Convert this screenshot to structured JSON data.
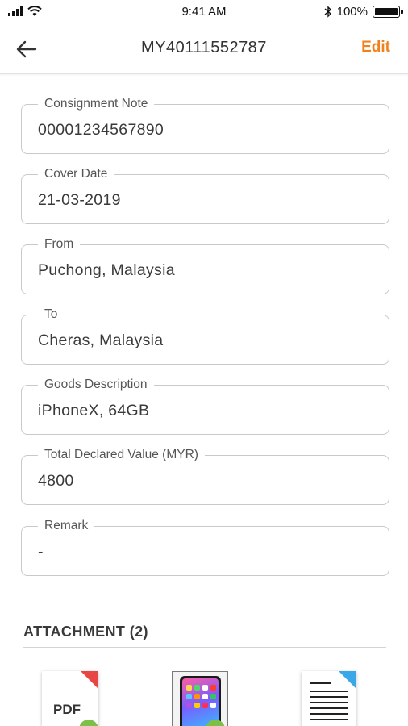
{
  "status_bar": {
    "time": "9:41 AM",
    "battery": "100%",
    "icons": [
      "signal-icon",
      "wifi-icon",
      "bluetooth-icon",
      "battery-icon"
    ]
  },
  "header": {
    "title": "MY40111552787",
    "edit_label": "Edit",
    "back_icon": "back-arrow-icon",
    "accent_color": "#f0821e"
  },
  "fields": [
    {
      "label": "Consignment Note",
      "value": "00001234567890"
    },
    {
      "label": "Cover Date",
      "value": "21-03-2019"
    },
    {
      "label": "From",
      "value": "Puchong, Malaysia"
    },
    {
      "label": "To",
      "value": "Cheras, Malaysia"
    },
    {
      "label": "Goods Description",
      "value": "iPhoneX, 64GB"
    },
    {
      "label": "Total Declared Value (MYR)",
      "value": "4800"
    },
    {
      "label": "Remark",
      "value": "-"
    }
  ],
  "attachments": {
    "title": "ATTACHMENT (2)",
    "items": [
      {
        "type": "pdf",
        "label": "PDF",
        "icon": "pdf-file-icon"
      },
      {
        "type": "image",
        "icon": "phone-image-thumbnail"
      },
      {
        "type": "document",
        "icon": "document-file-icon"
      }
    ]
  }
}
